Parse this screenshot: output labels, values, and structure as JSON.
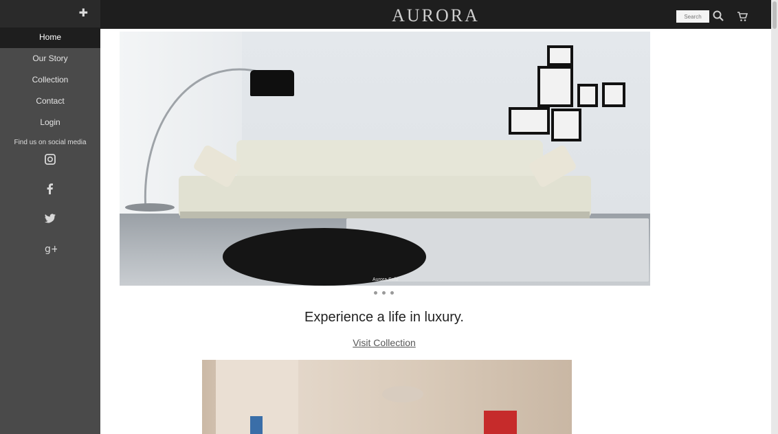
{
  "brand": {
    "name": "AURORA"
  },
  "sidebar": {
    "items": [
      {
        "label": "Home",
        "active": true
      },
      {
        "label": "Our Story",
        "active": false
      },
      {
        "label": "Collection",
        "active": false
      },
      {
        "label": "Contact",
        "active": false
      },
      {
        "label": "Login",
        "active": false
      }
    ],
    "social_label": "Find us on social media",
    "social_icons": [
      "instagram-icon",
      "facebook-icon",
      "twitter-icon",
      "google-plus-icon"
    ]
  },
  "header": {
    "search_placeholder": "Search",
    "icons": [
      "search-icon",
      "cart-icon"
    ]
  },
  "hero": {
    "caption": "Aurora Sofa",
    "slide_count": 3
  },
  "main": {
    "tagline": "Experience a life in luxury.",
    "cta_label": "Visit Collection"
  },
  "colors": {
    "sidebar_bg": "#4a4a4a",
    "header_bg": "#1e1e1e",
    "active_item_bg": "#1e1e1e"
  }
}
